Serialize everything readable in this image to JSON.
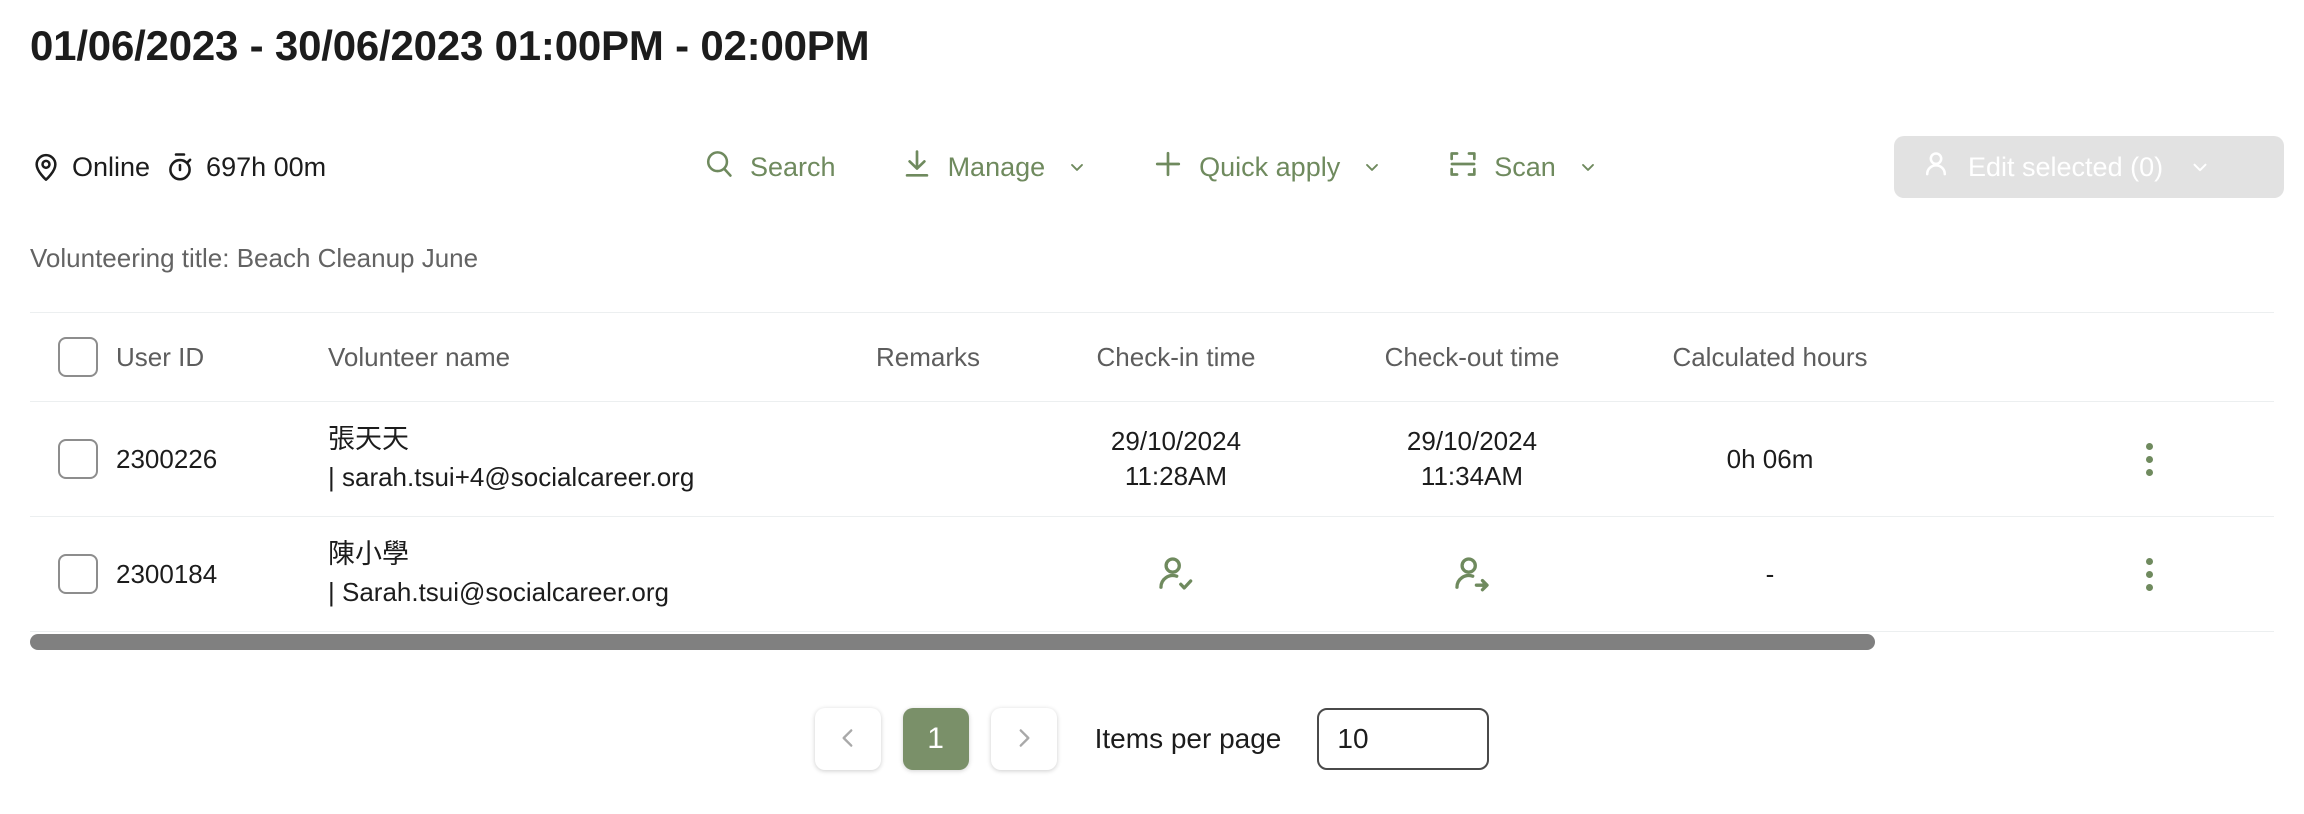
{
  "header": {
    "title": "01/06/2023 - 30/06/2023 01:00PM - 02:00PM"
  },
  "meta": {
    "location_icon": "location-pin-icon",
    "location_label": "Online",
    "duration_icon": "stopwatch-icon",
    "duration_label": "697h 00m"
  },
  "toolbar": {
    "search_label": "Search",
    "search_icon": "search-icon",
    "manage_label": "Manage",
    "manage_icon": "download-arrow-icon",
    "quick_apply_label": "Quick apply",
    "quick_apply_icon": "plus-icon",
    "scan_label": "Scan",
    "scan_icon": "scan-frame-icon",
    "edit_selected_label": "Edit selected (0)",
    "edit_selected_icon": "user-icon",
    "caret_icon": "chevron-down-icon"
  },
  "subtitle": "Volunteering title: Beach Cleanup June",
  "table": {
    "columns": [
      "User ID",
      "Volunteer name",
      "Remarks",
      "Check-in time",
      "Check-out time",
      "Calculated hours"
    ],
    "rows": [
      {
        "user_id": "2300226",
        "name": "張天天",
        "email": "| sarah.tsui+4@socialcareer.org",
        "remarks": "",
        "checkin_date": "29/10/2024",
        "checkin_time": "11:28AM",
        "checkout_date": "29/10/2024",
        "checkout_time": "11:34AM",
        "hours": "0h 06m",
        "checkin_is_icon": false,
        "checkout_is_icon": false
      },
      {
        "user_id": "2300184",
        "name": "陳小學",
        "email": "| Sarah.tsui@socialcareer.org",
        "remarks": "",
        "checkin_date": "",
        "checkin_time": "",
        "checkout_date": "",
        "checkout_time": "",
        "hours": "-",
        "checkin_is_icon": true,
        "checkout_is_icon": true,
        "checkin_icon": "user-check-in-icon",
        "checkout_icon": "user-check-out-icon"
      }
    ],
    "row_menu_icon": "kebab-menu-icon",
    "checkbox_icon": "checkbox-unchecked-icon"
  },
  "pagination": {
    "prev_icon": "chevron-left-icon",
    "next_icon": "chevron-right-icon",
    "current_page": "1",
    "items_per_page_label": "Items per page",
    "items_per_page_value": "10",
    "items_per_page_placeholder": "10"
  },
  "colors": {
    "accent_green": "#7a9069",
    "action_green": "#6f8a5e",
    "disabled_gray": "#e2e2e2",
    "scrollbar_gray": "#808080",
    "divider": "#eceff0"
  }
}
